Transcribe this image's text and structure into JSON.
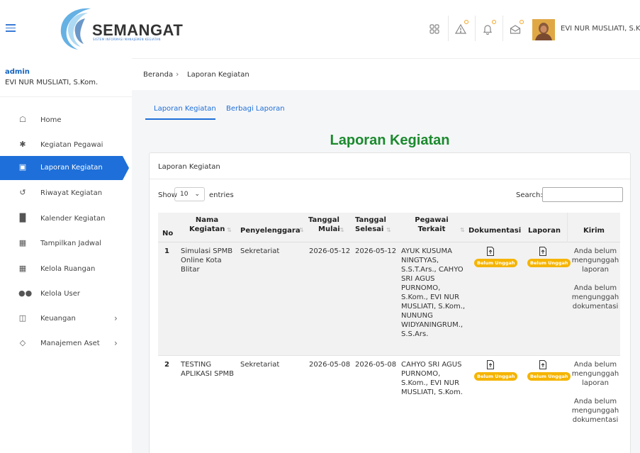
{
  "header": {
    "brand": "SEMANGAT",
    "brand_sub": "SISTEM INFORMASI MANAJEMEN KEGIATAN",
    "user_name": "EVI NUR MUSLIATI, S.Kom",
    "icons": [
      "grid-icon",
      "alert-icon",
      "bell-icon",
      "mail-icon"
    ],
    "accent": "#1e6fd9"
  },
  "sidebar": {
    "role": "admin",
    "name": "EVI NUR MUSLIATI, S.Kom.",
    "items": [
      {
        "label": "Home",
        "icon": "home-icon"
      },
      {
        "label": "Kegiatan Pegawai",
        "icon": "walk-icon"
      },
      {
        "label": "Laporan Kegiatan",
        "icon": "report-icon",
        "active": true
      },
      {
        "label": "Riwayat Kegiatan",
        "icon": "history-icon"
      },
      {
        "label": "Kalender Kegiatan",
        "icon": "building-icon"
      },
      {
        "label": "Tampilkan Jadwal",
        "icon": "city-icon"
      },
      {
        "label": "Kelola Ruangan",
        "icon": "city-icon"
      },
      {
        "label": "Kelola User",
        "icon": "users-icon"
      },
      {
        "label": "Keuangan",
        "icon": "layout-icon",
        "has_children": true
      },
      {
        "label": "Manajemen Aset",
        "icon": "box-icon",
        "has_children": true
      }
    ]
  },
  "breadcrumb": {
    "home": "Beranda",
    "current": "Laporan Kegiatan"
  },
  "tabs": [
    {
      "label": "Laporan Kegiatan",
      "active": true
    },
    {
      "label": "Berbagi Laporan"
    }
  ],
  "page_title": "Laporan Kegiatan",
  "card": {
    "title": "Laporan Kegiatan",
    "show_label": "Show",
    "show_value": "10",
    "entries_label": "entries",
    "search_label": "Search:"
  },
  "table": {
    "headers": {
      "no": "No",
      "nama_1": "Nama",
      "nama_2": "Kegiatan",
      "penyelenggara": "Penyelenggara",
      "mulai_1": "Tanggal",
      "mulai_2": "Mulai",
      "selesai_1": "Tanggal",
      "selesai_2": "Selesai",
      "pegawai_1": "Pegawai",
      "pegawai_2": "Terkait",
      "dokumentasi": "Dokumentasi",
      "laporan": "Laporan",
      "kirim": "Kirim"
    },
    "rows": [
      {
        "no": "1",
        "nama": [
          "Simulasi SPMB",
          "Online Kota",
          "Blitar"
        ],
        "penyelenggara": "Sekretariat",
        "mulai": "2026-05-12",
        "selesai": "2026-05-12",
        "pegawai": [
          "AYUK KUSUMA",
          "NINGTYAS,",
          "S.S.T.Ars., CAHYO",
          "SRI AGUS",
          "PURNOMO,",
          "S.Kom., EVI NUR",
          "MUSLIATI, S.Kom.,",
          "NUNUNG",
          "WIDYANINGRUM.,",
          "S.S.Ars."
        ],
        "dok_badge": "Belum Unggah",
        "lap_badge": "Belum Unggah",
        "kirim": [
          "Anda belum",
          "mengunggah",
          "laporan",
          "",
          "Anda belum",
          "mengunggah",
          "dokumentasi"
        ]
      },
      {
        "no": "2",
        "nama": [
          "TESTING",
          "APLIKASI SPMB"
        ],
        "penyelenggara": "Sekretariat",
        "mulai": "2026-05-08",
        "selesai": "2026-05-08",
        "pegawai": [
          "CAHYO SRI AGUS",
          "PURNOMO,",
          "S.Kom., EVI NUR",
          "MUSLIATI, S.Kom."
        ],
        "dok_badge": "Belum Unggah",
        "lap_badge": "Belum Unggah",
        "kirim": [
          "Anda belum",
          "mengunggah",
          "laporan",
          "",
          "Anda belum",
          "mengunggah",
          "dokumentasi"
        ]
      }
    ]
  }
}
